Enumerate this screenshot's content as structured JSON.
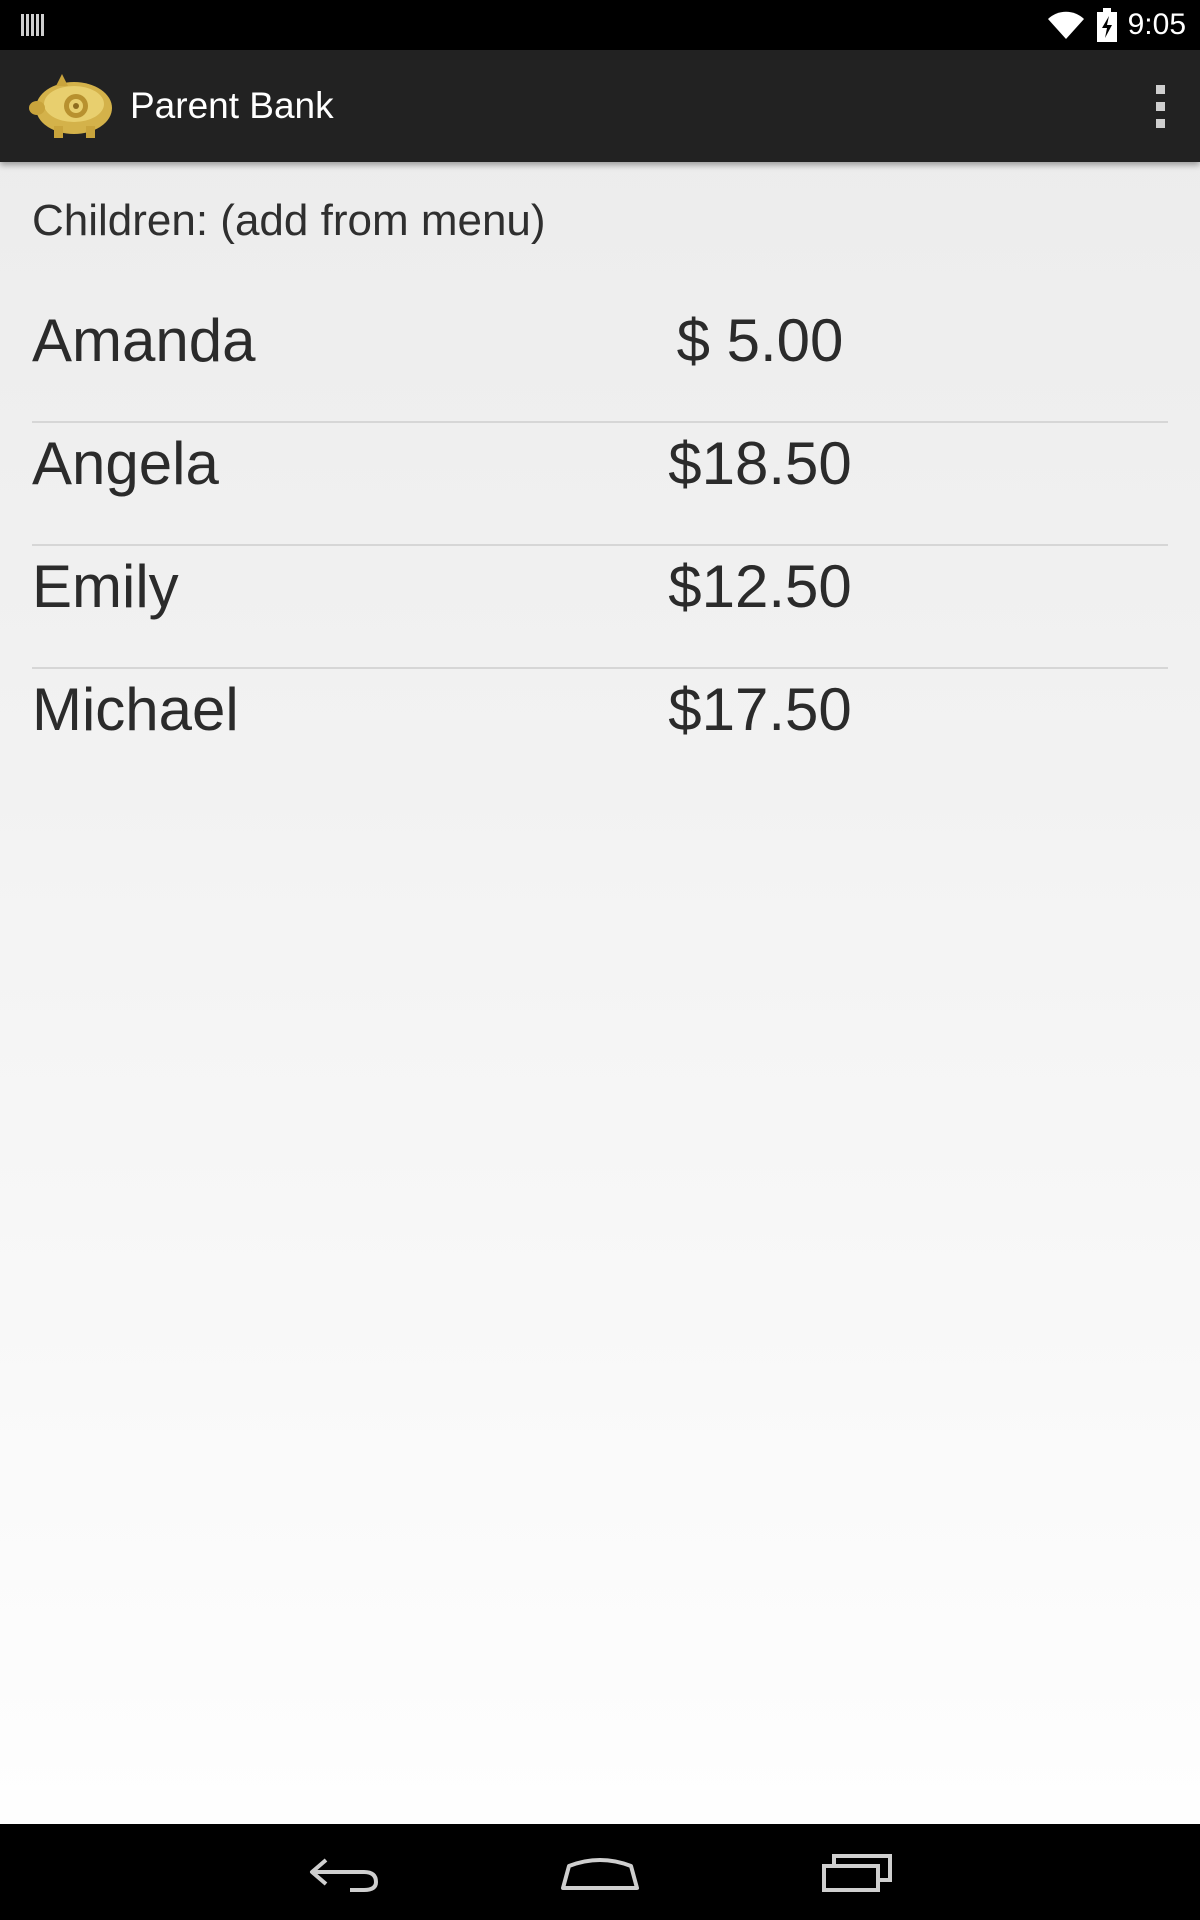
{
  "status_bar": {
    "time": "9:05",
    "left_icon": "barcode-icon",
    "icons": [
      "wifi-icon",
      "battery-charging-icon"
    ]
  },
  "action_bar": {
    "title": "Parent Bank",
    "logo_icon": "piggy-bank-icon",
    "overflow_icon": "overflow-menu-icon"
  },
  "main": {
    "heading": "Children: (add from menu)",
    "children": [
      {
        "name": "Amanda",
        "balance": "$ 5.00"
      },
      {
        "name": "Angela",
        "balance": "$18.50"
      },
      {
        "name": "Emily",
        "balance": "$12.50"
      },
      {
        "name": "Michael",
        "balance": "$17.50"
      }
    ]
  },
  "nav_bar": {
    "buttons": [
      "back-icon",
      "home-icon",
      "recent-apps-icon"
    ]
  },
  "colors": {
    "status_bar": "#000000",
    "action_bar": "#222222",
    "text": "#2b2b2b",
    "divider": "#d6d6d6",
    "logo_gold": "#d4b24a"
  }
}
